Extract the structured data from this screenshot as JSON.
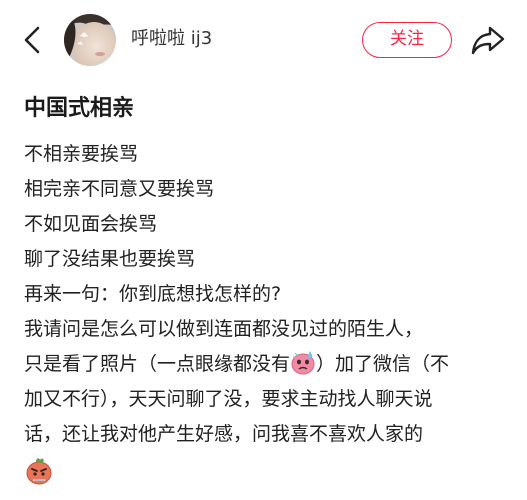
{
  "header": {
    "username": "呼啦啦 ij3",
    "follow_label": "关注"
  },
  "post": {
    "title": "中国式相亲",
    "lines": [
      "不相亲要挨骂",
      "相完亲不同意又要挨骂",
      "不如见面会挨骂",
      "聊了没结果也要挨骂",
      "再来一句：你到底想找怎样的?",
      "我请问是怎么可以做到连面都没见过的陌生人，"
    ],
    "line7_before_emoji": "只是看了照片（一点眼缘都没有",
    "line7_after_emoji": "）加了微信（不",
    "line8": "加又不行），天天问聊了没，要求主动找人聊天说",
    "line9": "话，还让我对他产生好感，问我喜不喜欢人家的"
  },
  "colors": {
    "accent": "#ff2442",
    "text": "#222222"
  },
  "icons": {
    "back": "chevron-left-icon",
    "share": "share-arrow-icon",
    "emoji_inline": "sweat-face-emoji-icon",
    "emoji_end": "angry-face-emoji-icon"
  }
}
